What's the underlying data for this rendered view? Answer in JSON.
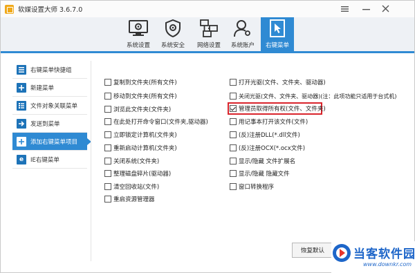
{
  "window": {
    "title": "软媒设置大师 3.6.7.0",
    "controls": [
      "menu-icon",
      "minimize-icon",
      "close-icon"
    ]
  },
  "toolbar": {
    "tabs": [
      {
        "label": "系统设置",
        "icon": "monitor-gear-icon",
        "active": false
      },
      {
        "label": "系统安全",
        "icon": "shield-icon",
        "active": false
      },
      {
        "label": "网络设置",
        "icon": "network-icon",
        "active": false
      },
      {
        "label": "系统账户",
        "icon": "user-account-icon",
        "active": false
      },
      {
        "label": "右键菜单",
        "icon": "cursor-click-icon",
        "active": true
      }
    ],
    "accent": "#2f8ad3"
  },
  "sidebar": {
    "items": [
      {
        "label": "右键菜单快捷组",
        "active": false
      },
      {
        "label": "新建菜单",
        "active": false
      },
      {
        "label": "文件对象关联菜单",
        "active": false
      },
      {
        "label": "发送到菜单",
        "active": false
      },
      {
        "label": "添加右键菜单项目",
        "active": true
      },
      {
        "label": "IE右键菜单",
        "active": false
      }
    ]
  },
  "options": {
    "left": [
      {
        "label": "复制到文件夹(所有文件)",
        "checked": false
      },
      {
        "label": "移动到文件夹(所有文件)",
        "checked": false
      },
      {
        "label": "浏览此文件夹(文件夹)",
        "checked": false
      },
      {
        "label": "在此处打开命令窗口(文件夹,驱动器)",
        "checked": false
      },
      {
        "label": "立即锁定计算机(文件夹)",
        "checked": false
      },
      {
        "label": "重新启动计算机(文件夹)",
        "checked": false
      },
      {
        "label": "关闭系统(文件夹)",
        "checked": false
      },
      {
        "label": "整理磁盘碎片(驱动器)",
        "checked": false
      },
      {
        "label": "清空回收站(文件)",
        "checked": false
      },
      {
        "label": "重启资源管理器",
        "checked": false
      }
    ],
    "right": [
      {
        "label": "打开光驱(文件、文件夹、驱动器)",
        "checked": false
      },
      {
        "label": "关闭光驱(文件、文件夹、驱动器)(注：此项功能只适用于台式机)",
        "checked": false
      },
      {
        "label": "管理员取得所有权(文件、文件夹)",
        "checked": true,
        "highlighted": true
      },
      {
        "label": "用记事本打开该文件(文件)",
        "checked": false
      },
      {
        "label": "(反)注册DLL(*.dll文件)",
        "checked": false
      },
      {
        "label": "(反)注册OCX(*.ocx文件)",
        "checked": false
      },
      {
        "label": "显示/隐藏 文件扩展名",
        "checked": false
      },
      {
        "label": "显示/隐藏 隐藏文件",
        "checked": false
      },
      {
        "label": "窗口转换程序",
        "checked": false
      }
    ]
  },
  "footer": {
    "restore_label": "恢复默认"
  },
  "watermark": {
    "name": "当客软件园",
    "url": "www.downkr.com"
  }
}
